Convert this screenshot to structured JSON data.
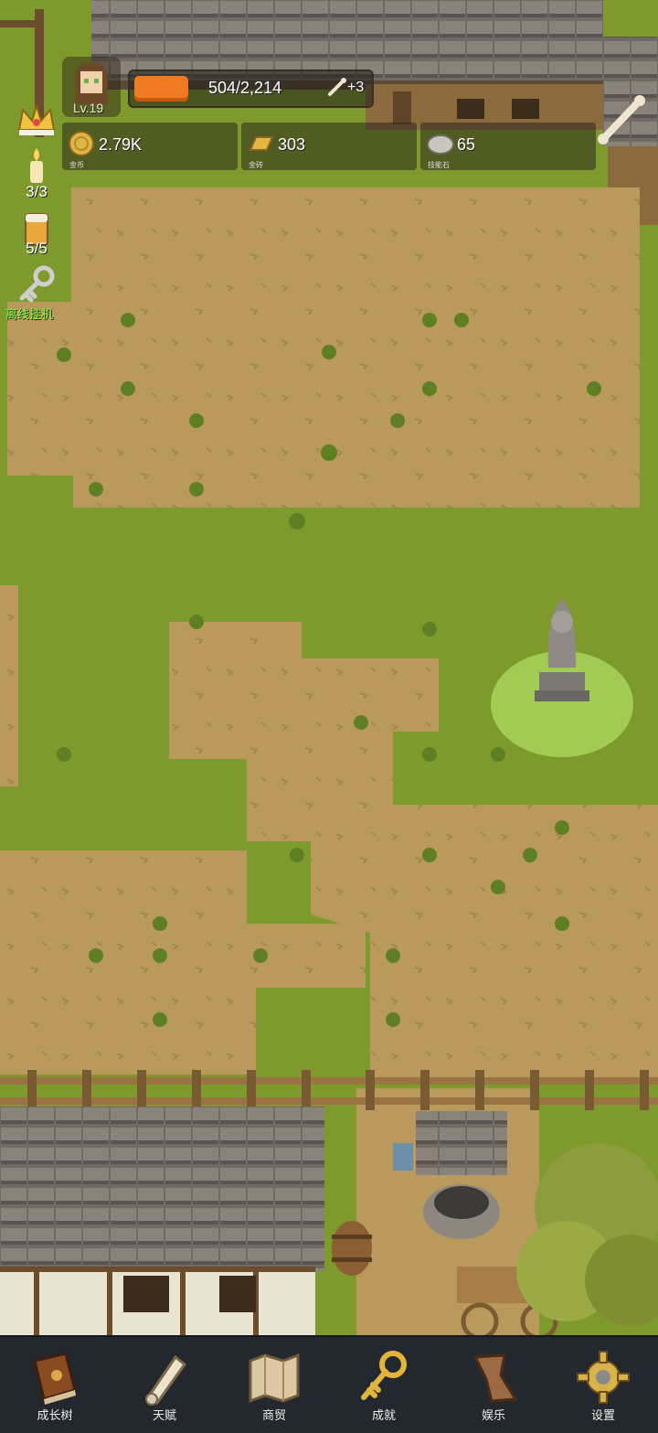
{
  "player": {
    "level": "Lv.19"
  },
  "xp": {
    "text": "504/2,214",
    "bonus": "+3",
    "progress": 0.23
  },
  "currencies": [
    {
      "name": "金币",
      "value": "2.79K",
      "icon": "gold-coin-icon"
    },
    {
      "name": "金砖",
      "value": "303",
      "icon": "gold-bar-icon"
    },
    {
      "name": "技能石",
      "value": "65",
      "icon": "skill-stone-icon"
    }
  ],
  "side": {
    "candle": "3/3",
    "beer": "5/5",
    "idle_label": "离线挂机"
  },
  "nav": [
    {
      "label": "成长树",
      "icon": "book-icon"
    },
    {
      "label": "天赋",
      "icon": "scroll-icon"
    },
    {
      "label": "商贸",
      "icon": "map-icon"
    },
    {
      "label": "成就",
      "icon": "key-icon"
    },
    {
      "label": "娱乐",
      "icon": "leather-icon"
    },
    {
      "label": "设置",
      "icon": "gear-icon"
    }
  ],
  "colors": {
    "xp_fill": "#f07a21",
    "idle_label": "#7dff3c",
    "nav_bg": "#23272e",
    "grass": "#7e9a2c",
    "dirt": "#b99a5c"
  }
}
